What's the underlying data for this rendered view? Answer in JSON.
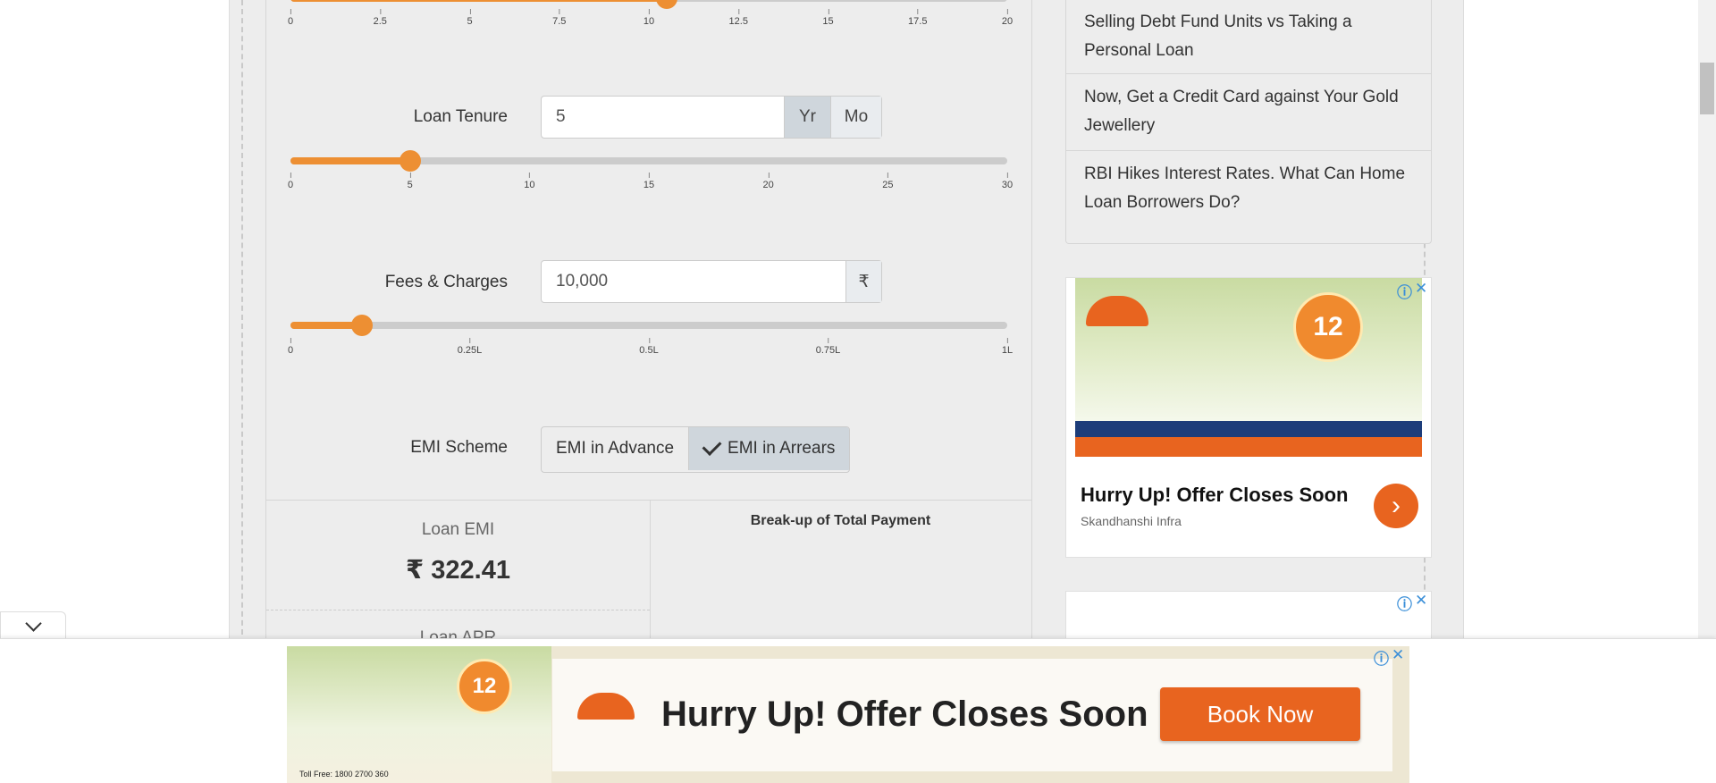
{
  "calculator": {
    "interest_ticks": [
      "0",
      "2.5",
      "5",
      "7.5",
      "10",
      "12.5",
      "15",
      "17.5",
      "20"
    ],
    "interest_value": 10.5,
    "tenure": {
      "label": "Loan Tenure",
      "value": "5",
      "unit_year": "Yr",
      "unit_month": "Mo",
      "ticks": [
        "0",
        "5",
        "10",
        "15",
        "20",
        "25",
        "30"
      ],
      "slider_fraction": 0.1667
    },
    "fees": {
      "label": "Fees & Charges",
      "value": "10,000",
      "currency": "₹",
      "ticks": [
        "0",
        "0.25L",
        "0.5L",
        "0.75L",
        "1L"
      ],
      "slider_fraction": 0.1
    },
    "scheme": {
      "label": "EMI Scheme",
      "advance": "EMI in Advance",
      "arrears": "EMI in Arrears",
      "selected": "arrears"
    },
    "results": {
      "emi_title": "Loan EMI",
      "emi_value": "₹ 322.41",
      "apr_title": "Loan APR",
      "breakup_title": "Break-up of Total Payment"
    },
    "accent_color": "#ed8f33"
  },
  "sidebar": {
    "articles": [
      {
        "title": "Selling Debt Fund Units vs Taking a Personal Loan"
      },
      {
        "title": "Now, Get a Credit Card against Your Gold Jewellery"
      },
      {
        "title": "RBI Hikes Interest Rates. What Can Home Loan Borrowers Do?"
      }
    ]
  },
  "ads": {
    "side_ad": {
      "badge": "12",
      "headline": "Hurry Up! Offer Closes Soon",
      "advertiser": "Skandhanshi Infra",
      "info_icon": "ⓘ",
      "close_icon": "✕"
    },
    "bottom_ad": {
      "headline": "Hurry Up! Offer Closes Soon",
      "button": "Book Now",
      "toll_free": "Toll Free: 1800 2700 360",
      "info_icon": "ⓘ",
      "close_icon": "✕"
    }
  }
}
